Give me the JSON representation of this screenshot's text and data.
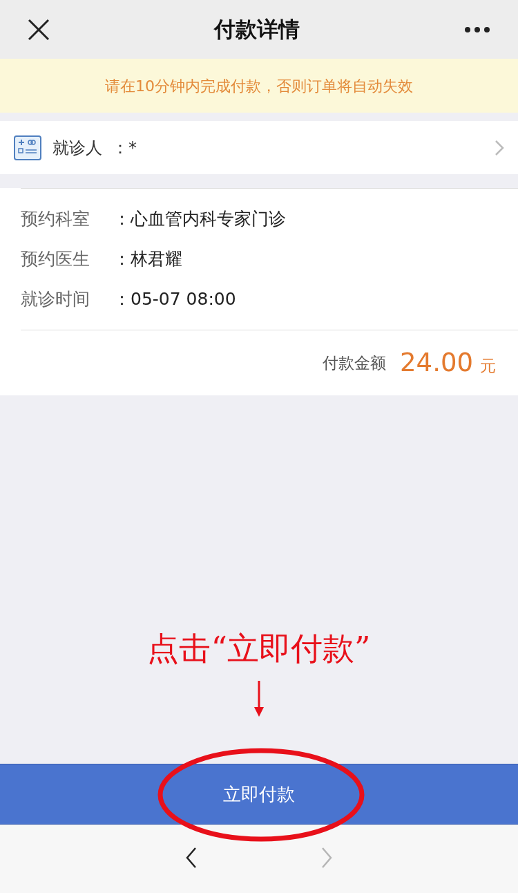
{
  "header": {
    "title": "付款详情"
  },
  "notice": "请在10分钟内完成付款，否则订单将自动失效",
  "patient": {
    "label": "就诊人",
    "value": "：*"
  },
  "details": [
    {
      "label": "预约科室",
      "value": "：心血管内科专家门诊"
    },
    {
      "label": "预约医生",
      "value": "：林君耀"
    },
    {
      "label": "就诊时间",
      "value": "：05-07 08:00"
    }
  ],
  "amount": {
    "label": "付款金额",
    "value": "24.00",
    "unit": "元"
  },
  "annotation": {
    "text": "点击“立即付款”"
  },
  "pay_button": {
    "label": "立即付款"
  },
  "nav": [
    {
      "kind": "back",
      "disabled": false
    },
    {
      "kind": "forward",
      "disabled": true
    }
  ]
}
